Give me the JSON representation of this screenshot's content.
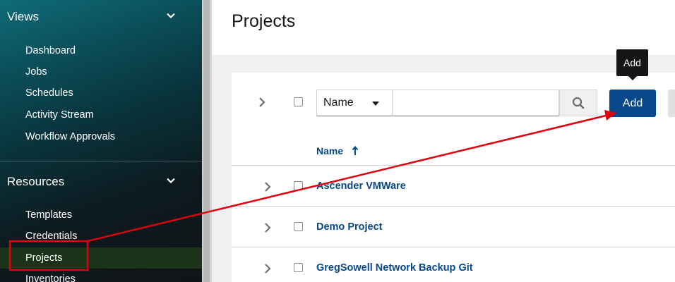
{
  "sidebar": {
    "views": {
      "label": "Views",
      "items": [
        "Dashboard",
        "Jobs",
        "Schedules",
        "Activity Stream",
        "Workflow Approvals"
      ]
    },
    "resources": {
      "label": "Resources",
      "items": [
        "Templates",
        "Credentials",
        "Projects",
        "Inventories"
      ]
    },
    "active_item": "Projects"
  },
  "header": {
    "title": "Projects"
  },
  "toolbar": {
    "filter_select": "Name",
    "search_value": "",
    "add_label": "Add",
    "tooltip": "Add"
  },
  "table": {
    "column_header": "Name",
    "rows": [
      {
        "name": "Ascender VMWare"
      },
      {
        "name": "Demo Project"
      },
      {
        "name": "GregSowell Network Backup Git"
      }
    ]
  },
  "colors": {
    "accent": "#06488a",
    "annotation": "#e0000e"
  }
}
